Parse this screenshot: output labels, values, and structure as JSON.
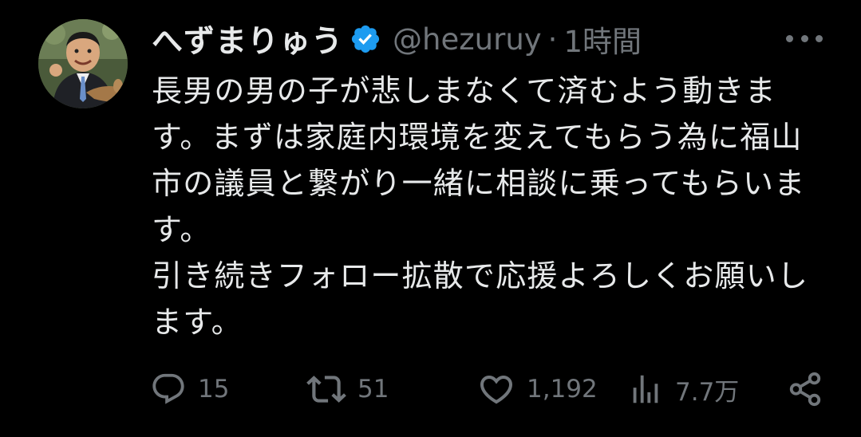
{
  "author": {
    "display_name": "へずまりゅう",
    "handle": "@hezuruy",
    "separator": "·",
    "time": "1時間",
    "verified": true,
    "verified_color": "#1d9bf0"
  },
  "tweet": {
    "paragraphs": [
      "長男の男の子が悲しまなくて済むよう動きます。まずは家庭内環境を変えてもらう為に福山市の議員と繋がり一緒に相談に乗ってもらいます。",
      "引き続きフォロー拡散で応援よろしくお願いします。"
    ]
  },
  "actions": {
    "reply": {
      "icon": "reply-icon",
      "count": "15"
    },
    "retweet": {
      "icon": "retweet-icon",
      "count": "51"
    },
    "like": {
      "icon": "heart-icon",
      "count": "1,192"
    },
    "views": {
      "icon": "views-icon",
      "count": "7.7万"
    },
    "share": {
      "icon": "share-icon"
    }
  },
  "colors": {
    "background": "#000000",
    "primary_text": "#e7e9ea",
    "secondary_text": "#71767b"
  }
}
